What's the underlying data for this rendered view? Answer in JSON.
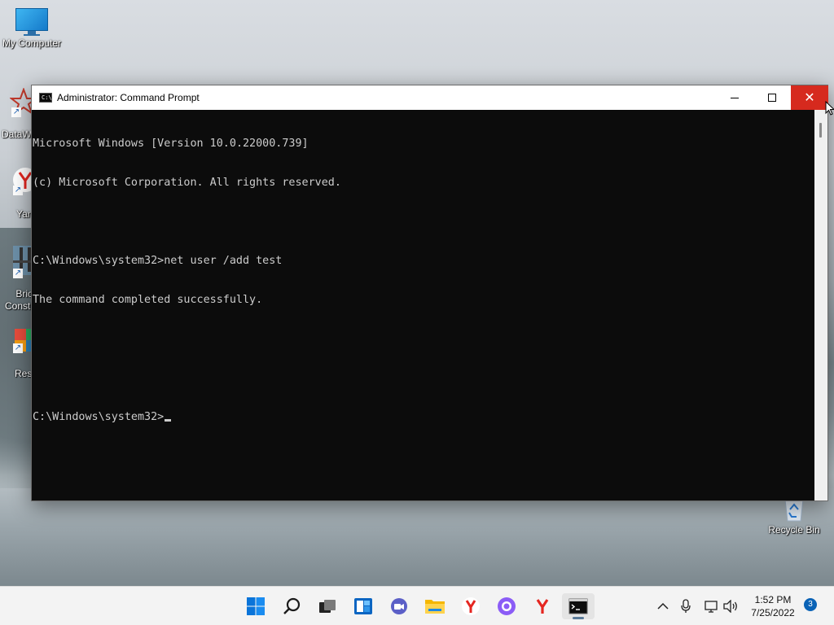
{
  "desktop": {
    "icons": [
      {
        "label": "My Computer"
      },
      {
        "label": "DataW"
      },
      {
        "label": "Yan"
      },
      {
        "label": "Bric\nConstr"
      },
      {
        "label": "Rest"
      },
      {
        "label": "Recycle Bin"
      }
    ]
  },
  "window": {
    "title": "Administrator: Command Prompt",
    "icon": "cmd-icon",
    "close_color": "#d62a1e"
  },
  "console": {
    "lines": [
      "Microsoft Windows [Version 10.0.22000.739]",
      "(c) Microsoft Corporation. All rights reserved.",
      "",
      "C:\\Windows\\system32>net user /add test",
      "The command completed successfully.",
      "",
      "",
      "C:\\Windows\\system32>"
    ]
  },
  "taskbar": {
    "apps": [
      "start-icon",
      "search-icon",
      "task-view-icon",
      "widgets-icon",
      "chat-icon",
      "file-explorer-icon",
      "yandex-browser-icon",
      "alice-icon",
      "yandex-icon",
      "command-prompt-icon"
    ],
    "tray": [
      "chevron-up-icon",
      "microphone-icon",
      "network-icon",
      "volume-icon"
    ],
    "time": "1:52 PM",
    "date": "7/25/2022",
    "notifications": "3"
  }
}
